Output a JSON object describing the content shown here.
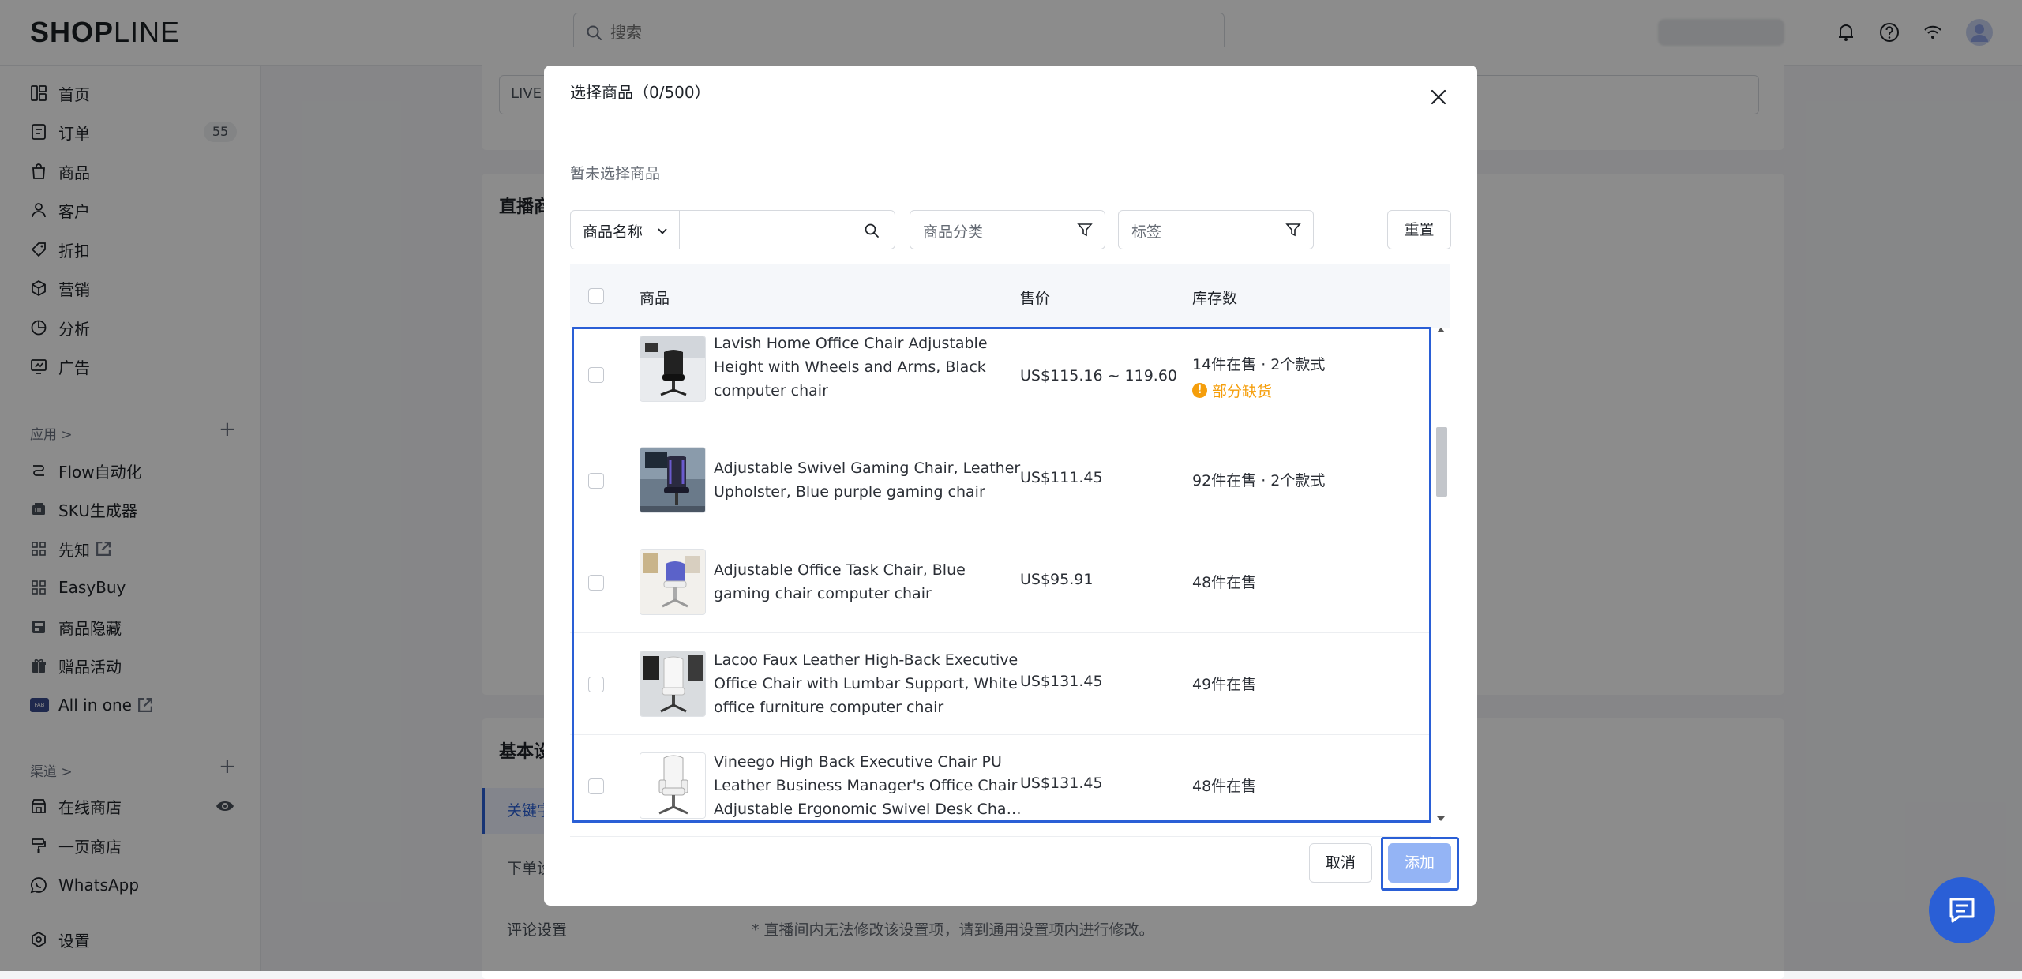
{
  "app": {
    "logo_bold": "SHOP",
    "logo_thin": "LINE"
  },
  "header": {
    "search_placeholder": "搜索"
  },
  "sidebar": {
    "main_items": [
      {
        "label": "首页",
        "icon": "dashboard-icon"
      },
      {
        "label": "订单",
        "icon": "order-icon",
        "badge": "55"
      },
      {
        "label": "商品",
        "icon": "bag-icon"
      },
      {
        "label": "客户",
        "icon": "user-icon"
      },
      {
        "label": "折扣",
        "icon": "tag-icon"
      },
      {
        "label": "营销",
        "icon": "marketing-icon"
      },
      {
        "label": "分析",
        "icon": "pie-chart-icon"
      },
      {
        "label": "广告",
        "icon": "ads-icon"
      }
    ],
    "apps_label": "应用 >",
    "apps": [
      {
        "label": "Flow自动化"
      },
      {
        "label": "SKU生成器"
      },
      {
        "label": "先知"
      },
      {
        "label": "EasyBuy"
      },
      {
        "label": "商品隐藏"
      },
      {
        "label": "赠品活动"
      },
      {
        "label": "All in one"
      }
    ],
    "allinone_logo_text": "FAB",
    "channels_label": "渠道 >",
    "channels": [
      {
        "label": "在线商店"
      },
      {
        "label": "一页商店"
      },
      {
        "label": "WhatsApp"
      }
    ],
    "settings_label": "设置"
  },
  "background": {
    "live_field": "LIVE",
    "section_live_goods": "直播商",
    "section_basic": "基本设",
    "tab_keyword": "关键字",
    "tab_order": "下单设",
    "tab_review": "评论设置",
    "note": "* 直播间内无法修改该设置项，请到通用设置项内进行修改。"
  },
  "modal": {
    "title": "选择商品（0/500）",
    "empty_text": "暂未选择商品",
    "filter_select": "商品名称",
    "filter_category": "商品分类",
    "filter_tag": "标签",
    "reset_button": "重置",
    "columns": {
      "product": "商品",
      "price": "售价",
      "stock": "库存数"
    },
    "rows": [
      {
        "name": "Lavish Home Office Chair Adjustable Height with Wheels and Arms, Black computer chair",
        "price": "US$115.16 ~ 119.60",
        "stock": "14件在售 · 2个款式",
        "warning": "部分缺货"
      },
      {
        "name": "Adjustable Swivel Gaming Chair, Leather Upholster, Blue purple gaming chair",
        "price": "US$111.45",
        "stock": "92件在售 · 2个款式"
      },
      {
        "name": "Adjustable Office Task Chair, Blue gaming chair computer chair",
        "price": "US$95.91",
        "stock": "48件在售"
      },
      {
        "name": "Lacoo Faux Leather High-Back Executive Office Chair with Lumbar Support, White office furniture computer chair",
        "price": "US$131.45",
        "stock": "49件在售"
      },
      {
        "name": "Vineego High Back Executive Chair PU Leather Business Manager's Office Chair Adjustable Ergonomic Swivel Desk Chair, White",
        "price": "US$131.45",
        "stock": "48件在售"
      }
    ],
    "cancel_button": "取消",
    "add_button": "添加"
  },
  "colors": {
    "primary": "#2a5fd6",
    "warning": "#f59e0b",
    "overlay": "rgba(0,0,0,0.45)"
  }
}
